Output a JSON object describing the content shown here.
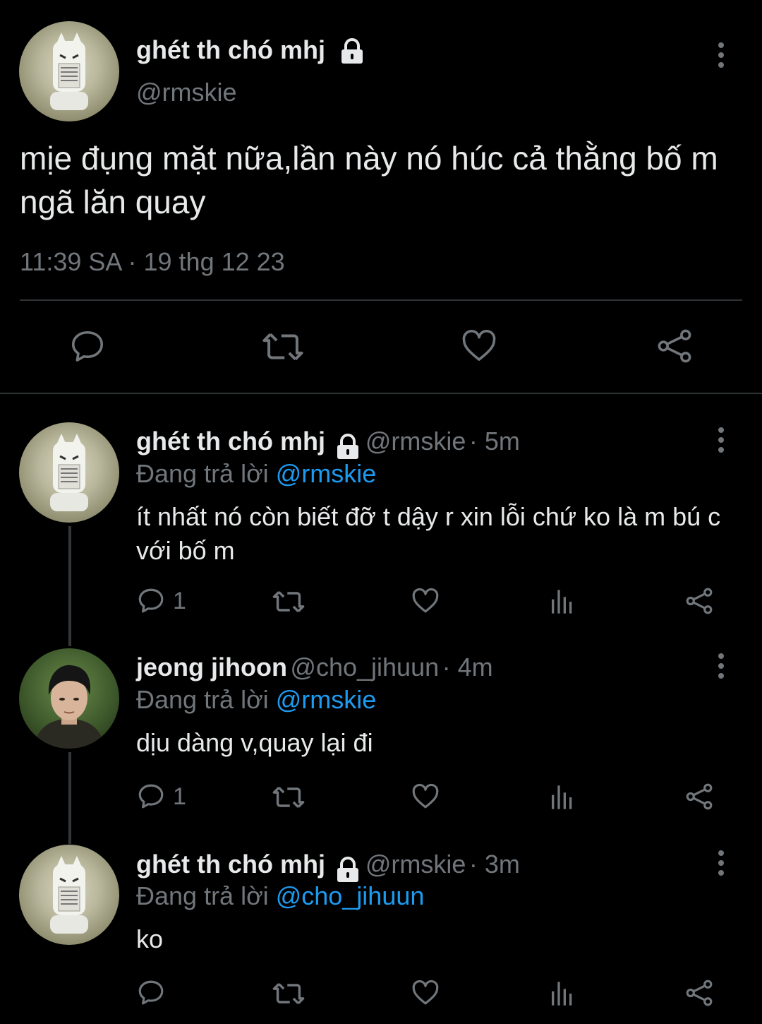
{
  "main_tweet": {
    "name": "ghét th chó mhj",
    "handle": "@rmskie",
    "text": "mịe đụng mặt nữa,lần này nó húc cả thằng bố m ngã lăn quay",
    "timestamp": "11:39 SA",
    "separator": "·",
    "date": "19 thg 12 23"
  },
  "replies": [
    {
      "name": "ghét th chó mhj",
      "handle": "@rmskie",
      "time": "· 5m",
      "replying_label": "Đang trả lời",
      "replying_to": "@rmskie",
      "text": "ít nhất nó còn biết đỡ t dậy r xin lỗi chứ ko là m bú c với bố m",
      "reply_count": "1"
    },
    {
      "name": "jeong jihoon",
      "handle": "@cho_jihuun",
      "time": "· 4m",
      "replying_label": "Đang trả lời",
      "replying_to": "@rmskie",
      "text": "dịu dàng v,quay lại đi",
      "reply_count": "1"
    },
    {
      "name": "ghét th chó mhj",
      "handle": "@rmskie",
      "time": "· 3m",
      "replying_label": "Đang trả lời",
      "replying_to": "@cho_jihuun",
      "text": "ko",
      "reply_count": ""
    }
  ],
  "colors": {
    "background": "#000000",
    "text": "#e7e9ea",
    "muted": "#71767b",
    "link": "#1d9bf0",
    "divider": "#2f3336"
  },
  "icons": [
    "more-icon",
    "lock-icon",
    "reply-icon",
    "retweet-icon",
    "like-icon",
    "views-icon",
    "share-icon"
  ]
}
